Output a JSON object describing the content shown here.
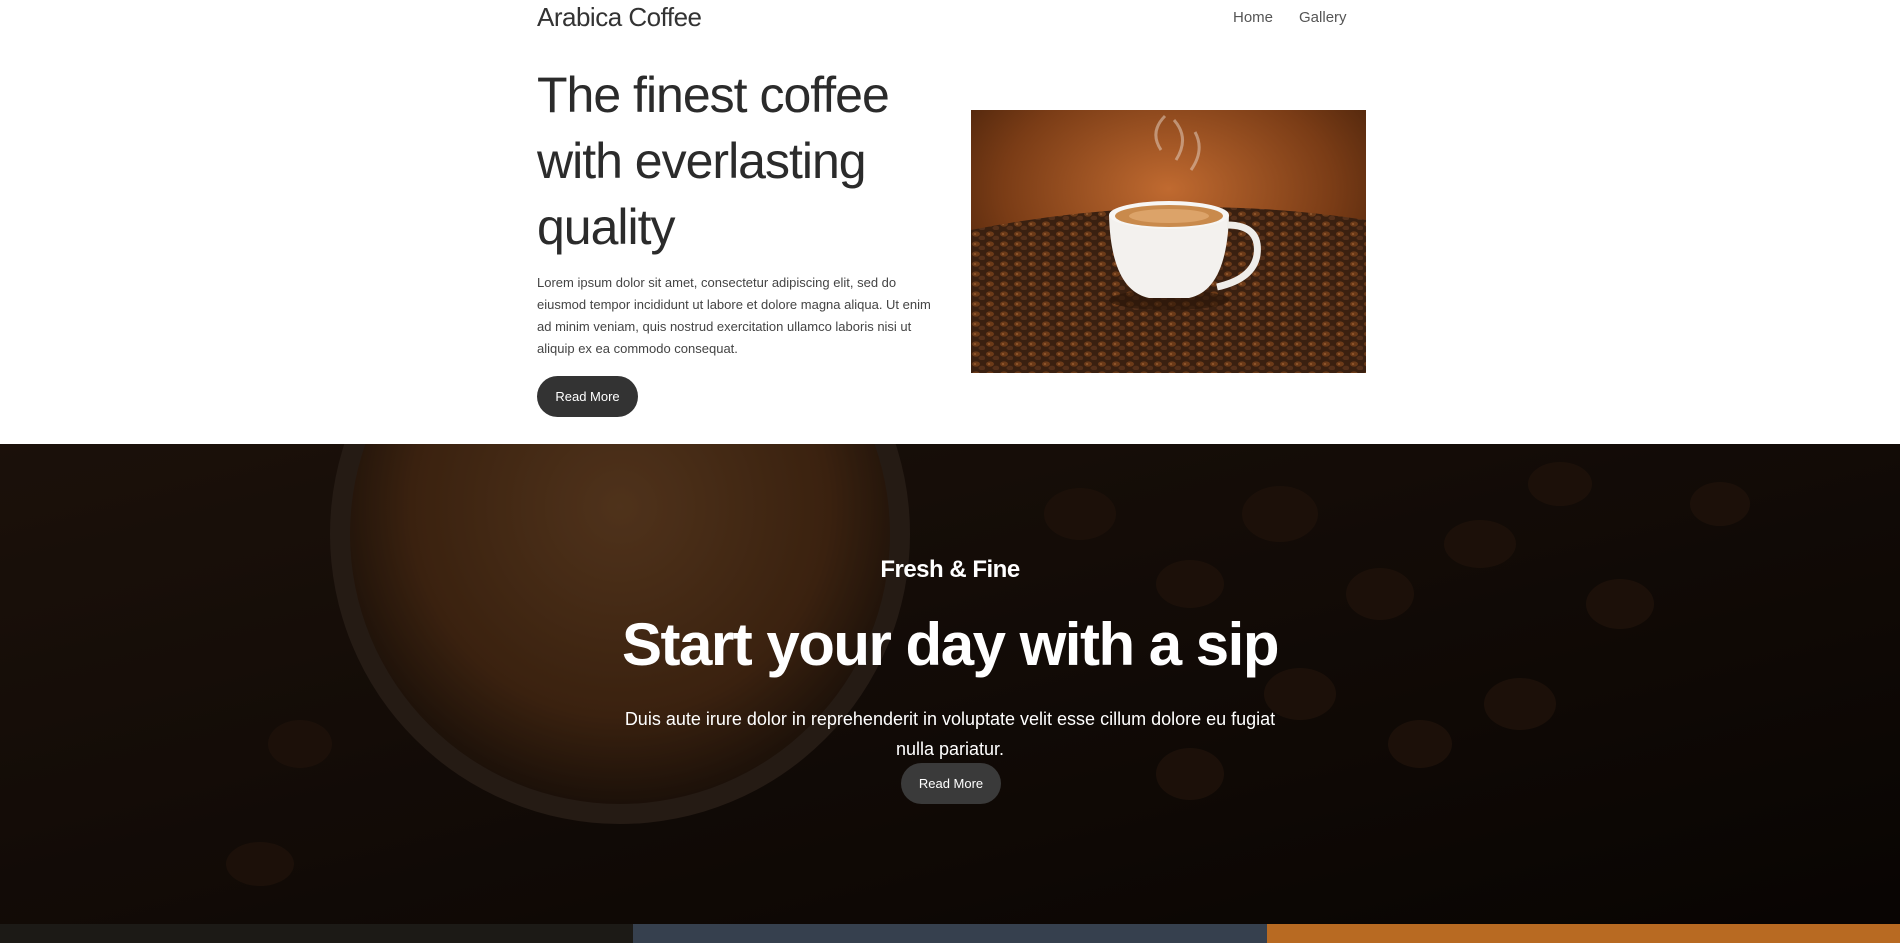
{
  "header": {
    "brand": "Arabica Coffee",
    "nav": [
      {
        "label": "Home"
      },
      {
        "label": "Gallery"
      }
    ]
  },
  "hero": {
    "title": "The finest coffee with everlasting quality",
    "text": "Lorem ipsum dolor sit amet, consectetur adipiscing elit, sed do eiusmod tempor incididunt ut labore et dolore magna aliqua. Ut enim ad minim veniam, quis nostrud exercitation ullamco laboris nisi ut aliquip ex ea commodo consequat.",
    "button": "Read More"
  },
  "banner": {
    "kicker": "Fresh & Fine",
    "title": "Start your day with a sip",
    "text": "Duis aute irure dolor in reprehenderit in voluptate velit esse cillum dolore eu fugiat nulla pariatur.",
    "button": "Read More"
  },
  "colors": {
    "text_dark": "#333333",
    "button_dark": "#333333",
    "banner_bg": "#1a110b"
  }
}
